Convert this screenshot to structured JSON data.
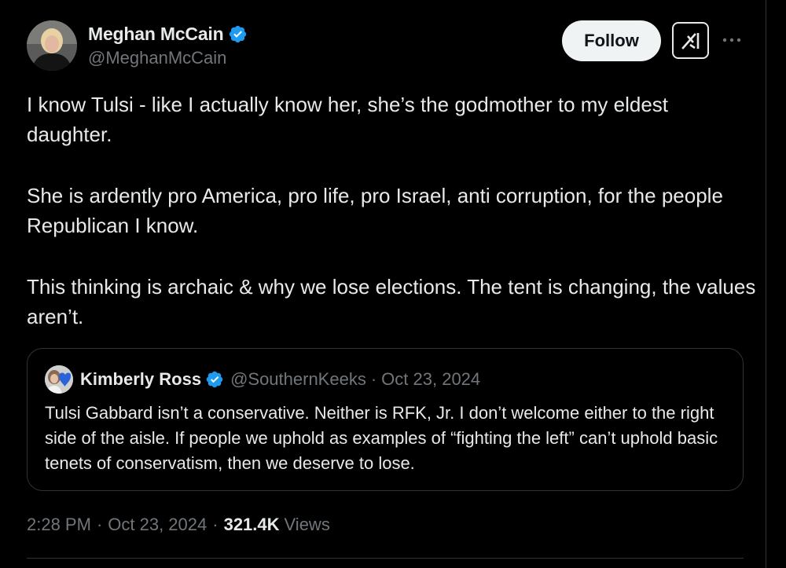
{
  "author": {
    "name": "Meghan McCain",
    "handle": "@MeghanMcCain",
    "verified": true
  },
  "actions": {
    "follow_label": "Follow",
    "grok_icon": "grok-icon",
    "more_icon": "more-icon"
  },
  "tweet": {
    "paragraphs": [
      "I know Tulsi - like I actually know her, she’s the godmother to my eldest daughter.",
      "She is ardently pro America, pro life, pro Israel, anti corruption, for the people Republican I know.",
      "This thinking is archaic & why we lose elections. The tent is changing, the values aren’t."
    ]
  },
  "quote": {
    "name": "Kimberly Ross",
    "handle": "@SouthernKeeks",
    "separator": "·",
    "date": "Oct 23, 2024",
    "text": "Tulsi Gabbard isn’t a conservative. Neither is RFK, Jr. I don’t welcome either to the right side of the aisle. If people we uphold as examples of “fighting the left” can’t uphold basic tenets of conservatism, then we deserve to lose."
  },
  "meta": {
    "time": "2:28 PM",
    "separator": "·",
    "date": "Oct 23, 2024",
    "views_count": "321.4K",
    "views_label": "Views"
  },
  "colors": {
    "background": "#000000",
    "text_primary": "#e7e9ea",
    "text_secondary": "#71767b",
    "verified_blue": "#1d9bf0",
    "border": "#2f3336",
    "follow_bg": "#eff3f4"
  }
}
